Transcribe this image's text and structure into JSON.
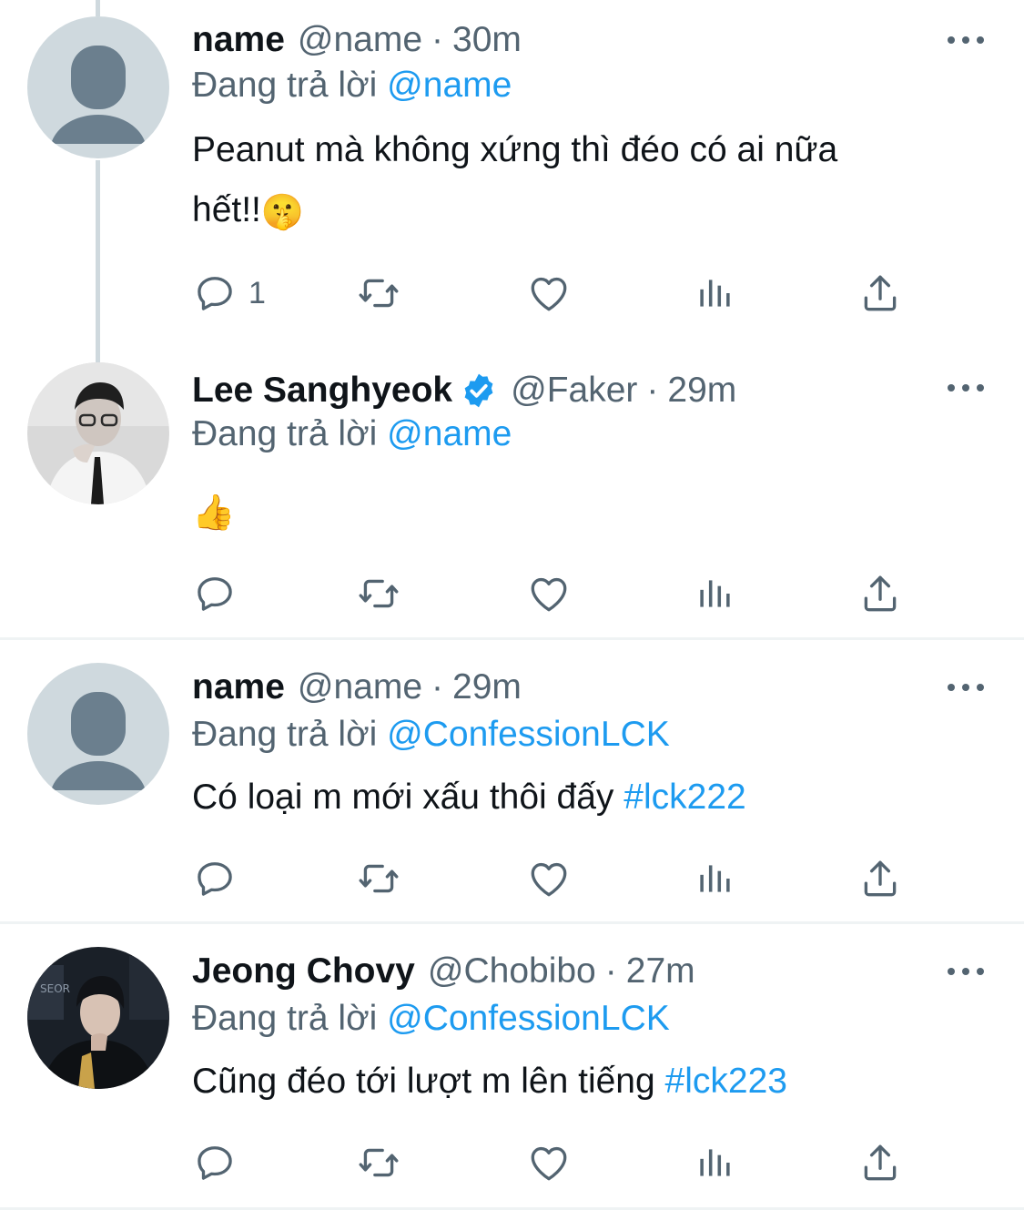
{
  "tweets": [
    {
      "display_name": "name",
      "handle": "@name",
      "time": "30m",
      "replying_prefix": "Đang trả lời",
      "replying_to": "@name",
      "text_line1": "Peanut mà không xứng thì đéo có ai nữa",
      "text_line2": "hết!!",
      "emoji": "🤫",
      "reply_count": "1",
      "avatar": "default-avatar",
      "verified": false
    },
    {
      "display_name": "Lee Sanghyeok",
      "handle": "@Faker",
      "time": "29m",
      "replying_prefix": "Đang trả lời",
      "replying_to": "@name",
      "emoji": "👍",
      "reply_count": "",
      "avatar": "photo-avatar",
      "verified": true
    },
    {
      "display_name": "name",
      "handle": "@name",
      "time": "29m",
      "replying_prefix": "Đang trả lời",
      "replying_to": "@ConfessionLCK",
      "text": "Có loại m mới xấu thôi đấy",
      "hashtag": "#lck222",
      "reply_count": "",
      "avatar": "default-avatar",
      "verified": false
    },
    {
      "display_name": "Jeong Chovy",
      "handle": "@Chobibo",
      "time": "27m",
      "replying_prefix": "Đang trả lời",
      "replying_to": "@ConfessionLCK",
      "text": "Cũng đéo tới lượt m lên tiếng",
      "hashtag": "#lck223",
      "reply_count": "",
      "avatar": "photo-avatar",
      "verified": false
    }
  ],
  "separator": "·",
  "icons": [
    "reply-icon",
    "retweet-icon",
    "like-icon",
    "views-icon",
    "share-icon",
    "more-icon",
    "verified-badge-icon"
  ],
  "colors": {
    "accent": "#1d9bf0",
    "secondary_text": "#536471",
    "avatar_bg": "#cfd9de",
    "avatar_fg": "#6b7f8e"
  }
}
